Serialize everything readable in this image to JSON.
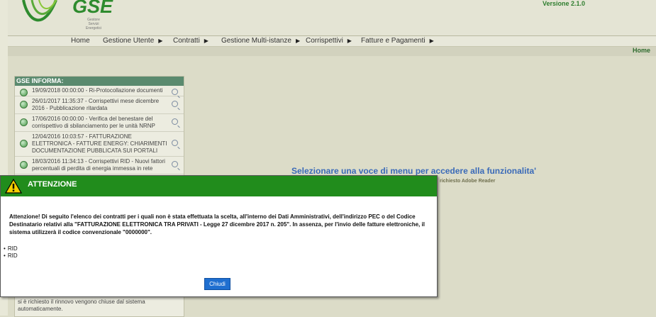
{
  "header": {
    "logo_text": "GSE",
    "logo_sub": "Gestore Servizi Energetici",
    "version": "Versione 2.1.0"
  },
  "nav": {
    "items": [
      {
        "label": "Home",
        "has_arrow": false
      },
      {
        "label": "Gestione Utente",
        "has_arrow": true
      },
      {
        "label": "Contratti",
        "has_arrow": true
      },
      {
        "label": "Gestione Multi-istanze",
        "has_arrow": true
      },
      {
        "label": "Corrispettivi",
        "has_arrow": true
      },
      {
        "label": "Fatture e Pagamenti",
        "has_arrow": true
      }
    ],
    "home_link": "Home"
  },
  "info_panel": {
    "title": "GSE INFORMA:",
    "items": [
      {
        "text": "19/09/2018 00:00:00 - Ri-Protocollazione documenti"
      },
      {
        "text": "26/01/2017 11:35:37 - Corrispettivi mese dicembre 2016 - Pubblicazione ritardata"
      },
      {
        "text": "17/06/2016 00:00:00 - Verifica del benestare del corrispettivo di sbilanciamento per le unità NRNP"
      },
      {
        "text": "12/04/2016 10:03:57 - FATTURAZIONE ELETTRONICA - FATTURE ENERGY: CHIARIMENTI DOCUMENTAZIONE PUBBLICATA SUI PORTALI"
      },
      {
        "text": "18/03/2016 11:34:13 - Corrispettivi RID - Nuovi fattori percentuali di perdita di energia immessa in rete"
      }
    ],
    "bottom_text": "si è richiesto il rinnovo vengono chiuse dal sistema automaticamente."
  },
  "main": {
    "welcome": "Selezionare una voce di menu per accedere alla funzionalita'",
    "reader_note": "richiesto Adobe Reader"
  },
  "modal": {
    "title": "ATTENZIONE",
    "message": "Attenzione! Di seguito l'elenco dei contratti per i quali non è stata effettuata la scelta, all'interno dei Dati Amministrativi, dell'indirizzo PEC o del Codice Destinatario relativi alla \"FATTURAZIONE ELETTRONICA TRA PRIVATI - Legge 27 dicembre 2017 n. 205\". In assenza, per l'invio delle fatture elettroniche, il sistema utilizzerà il codice convenzionale \"0000000\".",
    "list": [
      "RID",
      "RID"
    ],
    "close_label": "Chiudi"
  }
}
